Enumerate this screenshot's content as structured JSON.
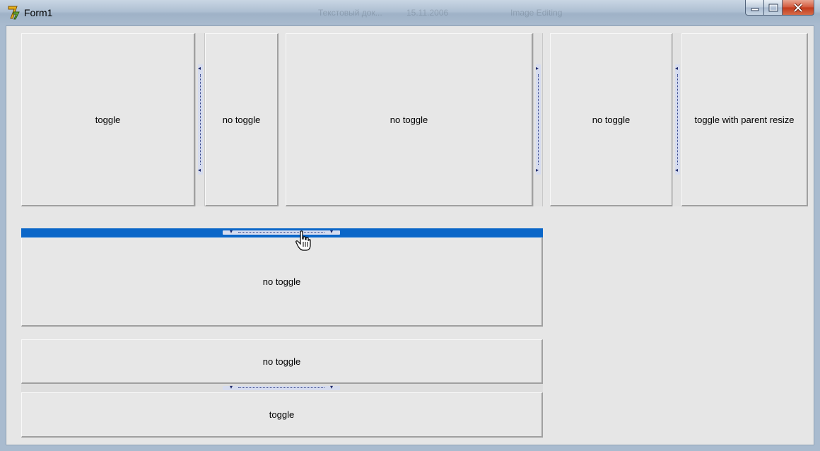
{
  "window": {
    "title": "Form1",
    "background_taskbar_text": [
      "Текстовый док...",
      "15.11.2006",
      "Image Editing"
    ]
  },
  "colors": {
    "client_bg": "#e6e6e6",
    "selected_splitter": "#0a66c8",
    "grip": "#d6dcef",
    "close_button": "#c2391b"
  },
  "icons": {
    "app": "lazarus-icon",
    "minimize": "minimize-icon",
    "maximize": "maximize-icon",
    "close": "close-icon",
    "cursor": "hand-pointer-cursor"
  },
  "panels": {
    "top_left_a": "toggle",
    "top_left_b": "no toggle",
    "top_middle": "no toggle",
    "top_right_a": "no toggle",
    "top_right_b": "toggle with parent resize",
    "middle": "no toggle",
    "bottom_upper": "no toggle",
    "bottom_lower": "toggle"
  }
}
